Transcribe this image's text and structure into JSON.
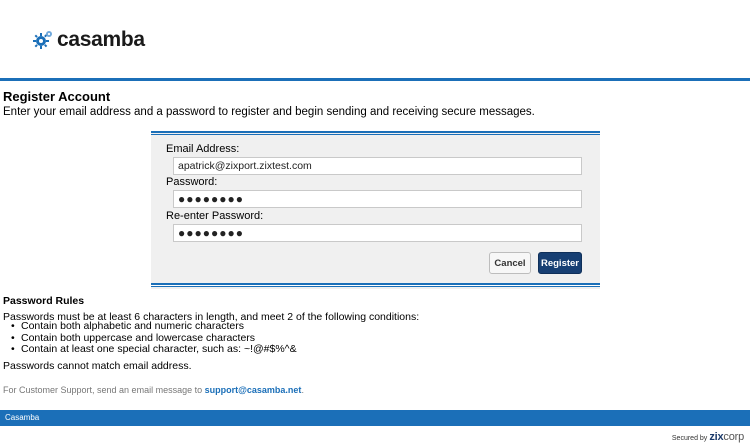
{
  "header": {
    "brand": "casamba"
  },
  "page": {
    "title": "Register Account",
    "subtitle": "Enter your email address and a password to register and begin sending and receiving secure messages."
  },
  "form": {
    "email_label": "Email Address:",
    "email_value": "apatrick@zixport.zixtest.com",
    "password_label": "Password:",
    "password_value": "●●●●●●●●",
    "reenter_label": "Re-enter Password:",
    "reenter_value": "●●●●●●●●",
    "cancel_label": "Cancel",
    "register_label": "Register"
  },
  "rules": {
    "title": "Password Rules",
    "intro": "Passwords must be at least 6 characters in length, and meet 2 of the following conditions:",
    "items": [
      "Contain both alphabetic and numeric characters",
      "Contain both uppercase and lowercase characters",
      "Contain at least one special character, such as: ~!@#$%^&"
    ],
    "note": "Passwords cannot match email address."
  },
  "support": {
    "text": "For Customer Support, send an email message to",
    "email": "support@casamba.net",
    "suffix": "."
  },
  "footer": {
    "brand": "Casamba",
    "secured_label": "Secured by",
    "secured_brand_a": "zix",
    "secured_brand_b": "corp"
  },
  "colors": {
    "accent": "#1b6fb8",
    "primary_button": "#173f73"
  }
}
